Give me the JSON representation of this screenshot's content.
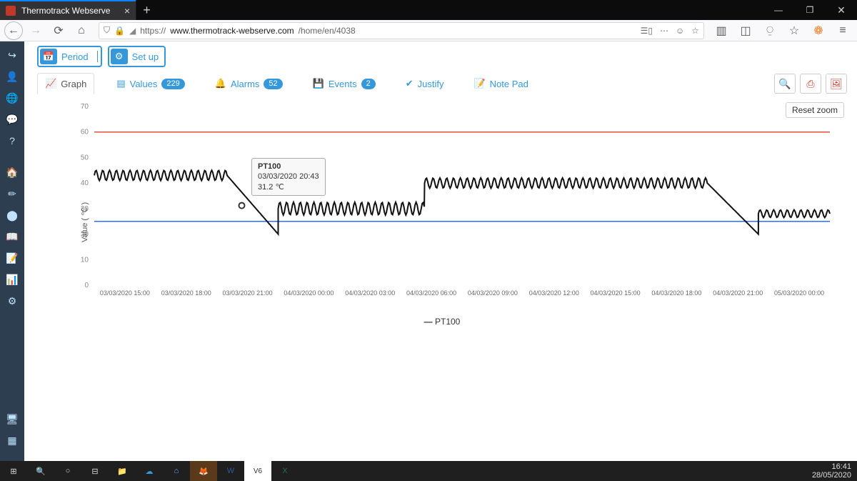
{
  "browser": {
    "tab_title": "Thermotrack Webserve",
    "url_prefix": "https://",
    "url_host": "www.thermotrack-webserve.com",
    "url_path": "/home/en/4038"
  },
  "topbuttons": {
    "period": "Period",
    "setup": "Set up"
  },
  "tabs": {
    "graph": "Graph",
    "values": "Values",
    "values_count": "229",
    "alarms": "Alarms",
    "alarms_count": "52",
    "events": "Events",
    "events_count": "2",
    "justify": "Justify",
    "notepad": "Note Pad"
  },
  "chart_controls": {
    "reset_zoom": "Reset zoom"
  },
  "tooltip": {
    "series": "PT100",
    "timestamp": "03/03/2020 20:43",
    "value": "31.2 ℃"
  },
  "axis_y_label": "Value ( ℃ )",
  "legend": "PT100",
  "clock": {
    "time": "16:41",
    "date": "28/05/2020"
  },
  "chart_data": {
    "type": "line",
    "series": [
      {
        "name": "PT100"
      }
    ],
    "ylabel": "Value ( ℃ )",
    "ylim": [
      0,
      70
    ],
    "y_ticks": [
      0,
      10,
      20,
      30,
      40,
      50,
      60,
      70
    ],
    "reference_lines": [
      {
        "name": "upper-limit",
        "value": 60,
        "color": "#e74c3c"
      },
      {
        "name": "lower-limit",
        "value": 25,
        "color": "#2e6ef7"
      }
    ],
    "x_ticks": [
      "03/03/2020 15:00",
      "03/03/2020 18:00",
      "03/03/2020 21:00",
      "04/03/2020 00:00",
      "04/03/2020 03:00",
      "04/03/2020 06:00",
      "04/03/2020 09:00",
      "04/03/2020 12:00",
      "04/03/2020 15:00",
      "04/03/2020 18:00",
      "04/03/2020 21:00",
      "05/03/2020 00:00"
    ],
    "x_range": [
      "03/03/2020 13:30",
      "05/03/2020 01:30"
    ],
    "tooltip_point": {
      "x": "03/03/2020 20:43",
      "y": 31.2
    },
    "segments_approx": [
      {
        "from": "03/03/2020 13:30",
        "to": "03/03/2020 20:00",
        "baseline": 43,
        "amplitude": 2.0,
        "period_min": 20
      },
      {
        "from": "03/03/2020 20:00",
        "to": "03/03/2020 22:30",
        "baseline_from": 43,
        "baseline_to": 20,
        "amplitude": 0,
        "ramp": true
      },
      {
        "from": "03/03/2020 22:30",
        "to": "04/03/2020 05:40",
        "baseline": 30,
        "amplitude": 2.5,
        "period_min": 20
      },
      {
        "from": "04/03/2020 05:40",
        "to": "04/03/2020 19:30",
        "baseline": 40,
        "amplitude": 2.0,
        "period_min": 20
      },
      {
        "from": "04/03/2020 19:30",
        "to": "04/03/2020 22:00",
        "baseline_from": 40,
        "baseline_to": 20,
        "amplitude": 0,
        "ramp": true
      },
      {
        "from": "04/03/2020 22:00",
        "to": "05/03/2020 01:30",
        "baseline": 28,
        "amplitude": 1.5,
        "period_min": 20
      }
    ]
  }
}
